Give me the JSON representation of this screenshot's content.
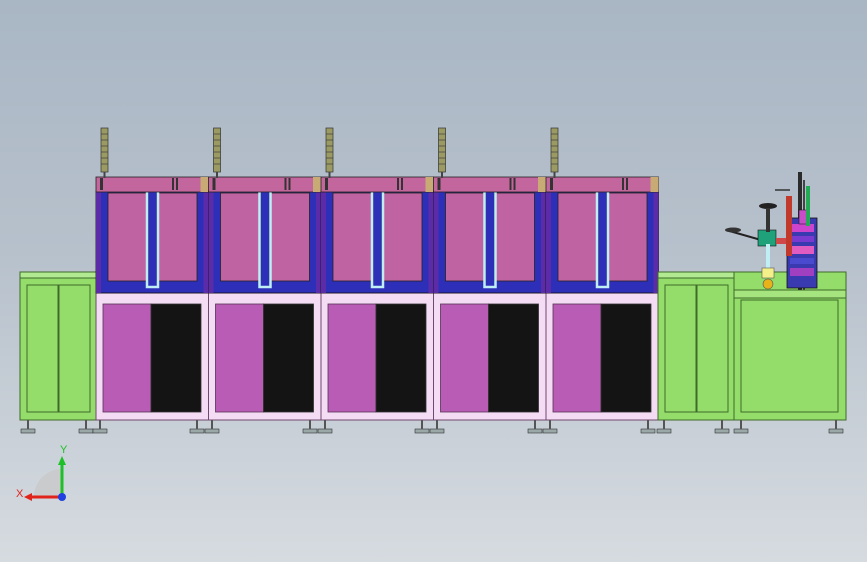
{
  "viewport": {
    "background_top": "#a9b6c4",
    "background_bottom": "#d6dbe0"
  },
  "machine": {
    "module_count": 5,
    "colors": {
      "frame_green": "#94dd6a",
      "frame_green_dark": "#5d9a3f",
      "chamber_magenta": "#c063a3",
      "chamber_border_blue": "#2d2fb8",
      "chamber_purple_post": "#5b2ba8",
      "lower_panel_magenta": "#b95cb5",
      "lower_panel_black": "#141414",
      "lower_frame_pink": "#f4dcf4",
      "duct_cyan": "#bfeff5",
      "top_rail_magenta": "#c4669e",
      "signal_tower": "#9a9a62",
      "foot_grey": "#9aa8a8"
    }
  },
  "triad": {
    "x_label": "X",
    "y_label": "Y",
    "x_color": "#e0241c",
    "y_color": "#1fbf2a",
    "z_color": "#2040e0"
  }
}
